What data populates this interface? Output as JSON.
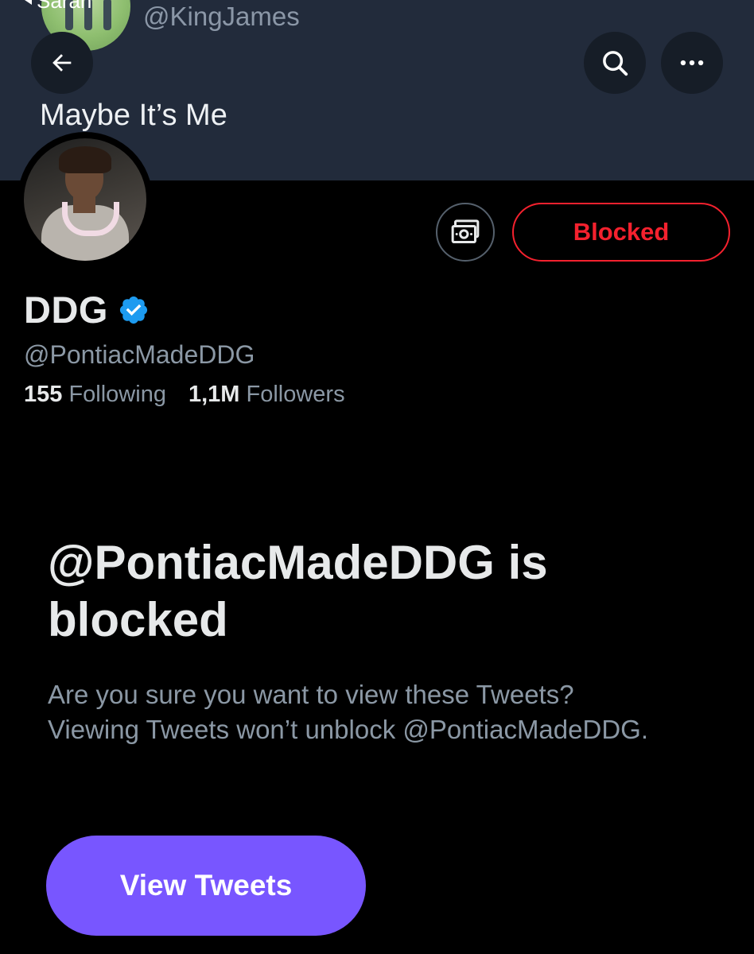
{
  "banner": {
    "prev_label": "Sarah",
    "prev_handle": "@KingJames",
    "subtitle": "Maybe It’s Me"
  },
  "nav": {
    "back_icon": "arrow-left-icon",
    "search_icon": "search-icon",
    "more_icon": "more-horizontal-icon"
  },
  "profile": {
    "display_name": "DDG",
    "verified": true,
    "handle": "@PontiacMadeDDG",
    "following_count": "155",
    "following_label": "Following",
    "followers_count": "1,1M",
    "followers_label": "Followers"
  },
  "actions": {
    "tip_icon": "money-icon",
    "blocked_label": "Blocked"
  },
  "blocked_notice": {
    "title": "@PontiacMadeDDG is blocked",
    "description": "Are you sure you want to view these Tweets? Viewing Tweets won’t unblock @PontiacMadeDDG.",
    "button_label": "View Tweets"
  },
  "colors": {
    "banner_bg": "#222b3b",
    "blocked_red": "#f4212e",
    "view_button": "#7856ff",
    "verified_blue": "#1d9bf0",
    "muted_text": "#8b98a5"
  }
}
